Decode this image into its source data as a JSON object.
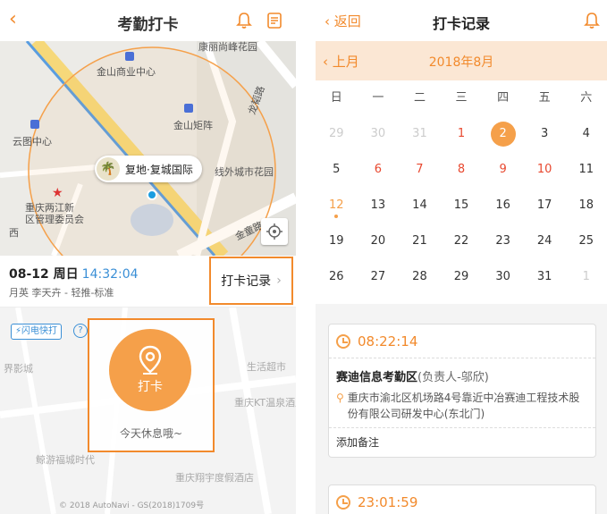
{
  "left": {
    "title": "考勤打卡",
    "back_icon": "chevron-left-icon",
    "map": {
      "labels": {
        "top": "康丽尚峰花园",
        "jinshan_mall": "金山商业中心",
        "jinshan_tower": "金山矩阵",
        "yuntu": "云图中心",
        "longzhan_road": "龙韬路",
        "xianwai": "线外城市花园",
        "gov": "重庆两江新\n区管理委员会",
        "jinshan_road": "金童路",
        "xi_road": "西"
      },
      "callout": "复地·复城国际"
    },
    "date": "08-12 周日",
    "time": "14:32:04",
    "sub": "月英 李天卉 - 轻推-标准",
    "record_button": "打卡记录",
    "flash_label": "闪电快打",
    "help_label": "?",
    "punch_label": "打卡",
    "rest_text": "今天休息哦~",
    "lower_labels": {
      "l1": "界影城",
      "l2": "生活超市",
      "l3": "重庆KT温泉酒店",
      "l4": "鲸游福城时代",
      "l5": "重庆翔宇度假酒店"
    },
    "copyright": "© 2018 AutoNavi - GS(2018)1709号"
  },
  "right": {
    "back_label": "返回",
    "title": "打卡记录",
    "prev_month": "上月",
    "current_month": "2018年8月",
    "weekdays": [
      "日",
      "一",
      "二",
      "三",
      "四",
      "五",
      "六"
    ],
    "weeks": [
      [
        "29",
        "30",
        "31",
        "1",
        "2",
        "3",
        "4"
      ],
      [
        "5",
        "6",
        "7",
        "8",
        "9",
        "10",
        "11"
      ],
      [
        "12",
        "13",
        "14",
        "15",
        "16",
        "17",
        "18"
      ],
      [
        "19",
        "20",
        "21",
        "22",
        "23",
        "24",
        "25"
      ],
      [
        "26",
        "27",
        "28",
        "29",
        "30",
        "31",
        "1"
      ]
    ],
    "card1": {
      "time": "08:22:14",
      "area": "赛迪信息考勤区",
      "owner": "(负责人-邬欣)",
      "address": "重庆市渝北区机场路4号靠近中冶赛迪工程技术股份有限公司研发中心(东北门)",
      "note": "添加备注"
    },
    "card2": {
      "time": "23:01:59"
    }
  },
  "colors": {
    "accent": "#f28a2c",
    "highlight": "#f5a04a",
    "red": "#e8482f",
    "blue": "#3a8fd6"
  }
}
